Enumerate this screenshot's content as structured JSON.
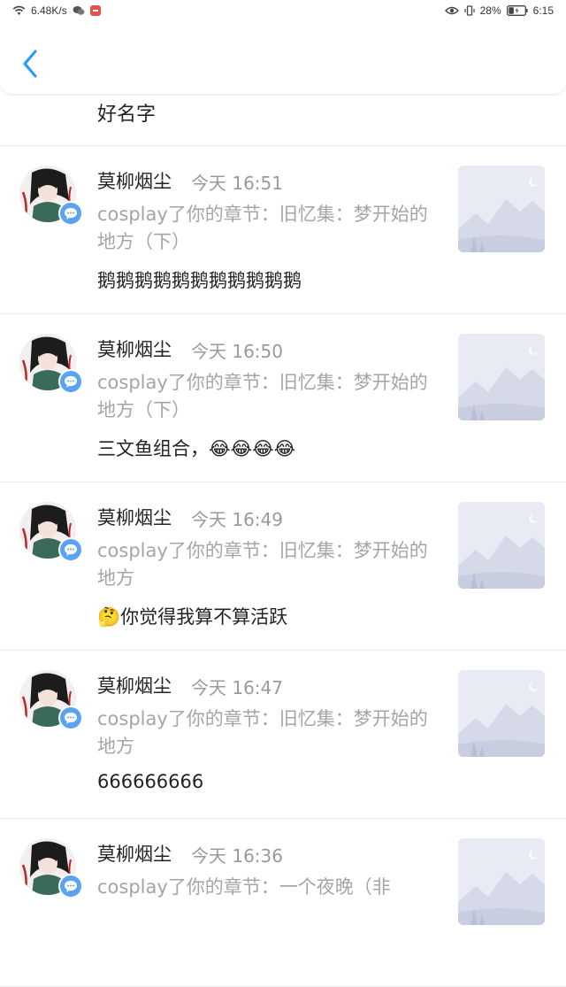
{
  "status_bar": {
    "speed": "6.48K/s",
    "battery": "28%",
    "time": "6:15"
  },
  "header": {
    "back_icon": "chevron-left-icon"
  },
  "partial_item": {
    "text": "好名字"
  },
  "items": [
    {
      "name": "莫柳烟尘",
      "time": "今天 16:51",
      "desc": "cosplay了你的章节：旧忆集：梦开始的地方（下）",
      "comment": "鹅鹅鹅鹅鹅鹅鹅鹅鹅鹅鹅"
    },
    {
      "name": "莫柳烟尘",
      "time": "今天 16:50",
      "desc": "cosplay了你的章节：旧忆集：梦开始的地方（下）",
      "comment": "三文鱼组合，😂😂😂😂"
    },
    {
      "name": "莫柳烟尘",
      "time": "今天 16:49",
      "desc": "cosplay了你的章节：旧忆集：梦开始的地方",
      "comment": "🤔你觉得我算不算活跃"
    },
    {
      "name": "莫柳烟尘",
      "time": "今天 16:47",
      "desc": "cosplay了你的章节：旧忆集：梦开始的地方",
      "comment": "666666666"
    },
    {
      "name": "莫柳烟尘",
      "time": "今天 16:36",
      "desc": "cosplay了你的章节：一个夜晚（非",
      "comment": ""
    }
  ],
  "colors": {
    "accent": "#2b9cef",
    "badge": "#5aa2f2",
    "muted_text": "#a5a5a5"
  }
}
